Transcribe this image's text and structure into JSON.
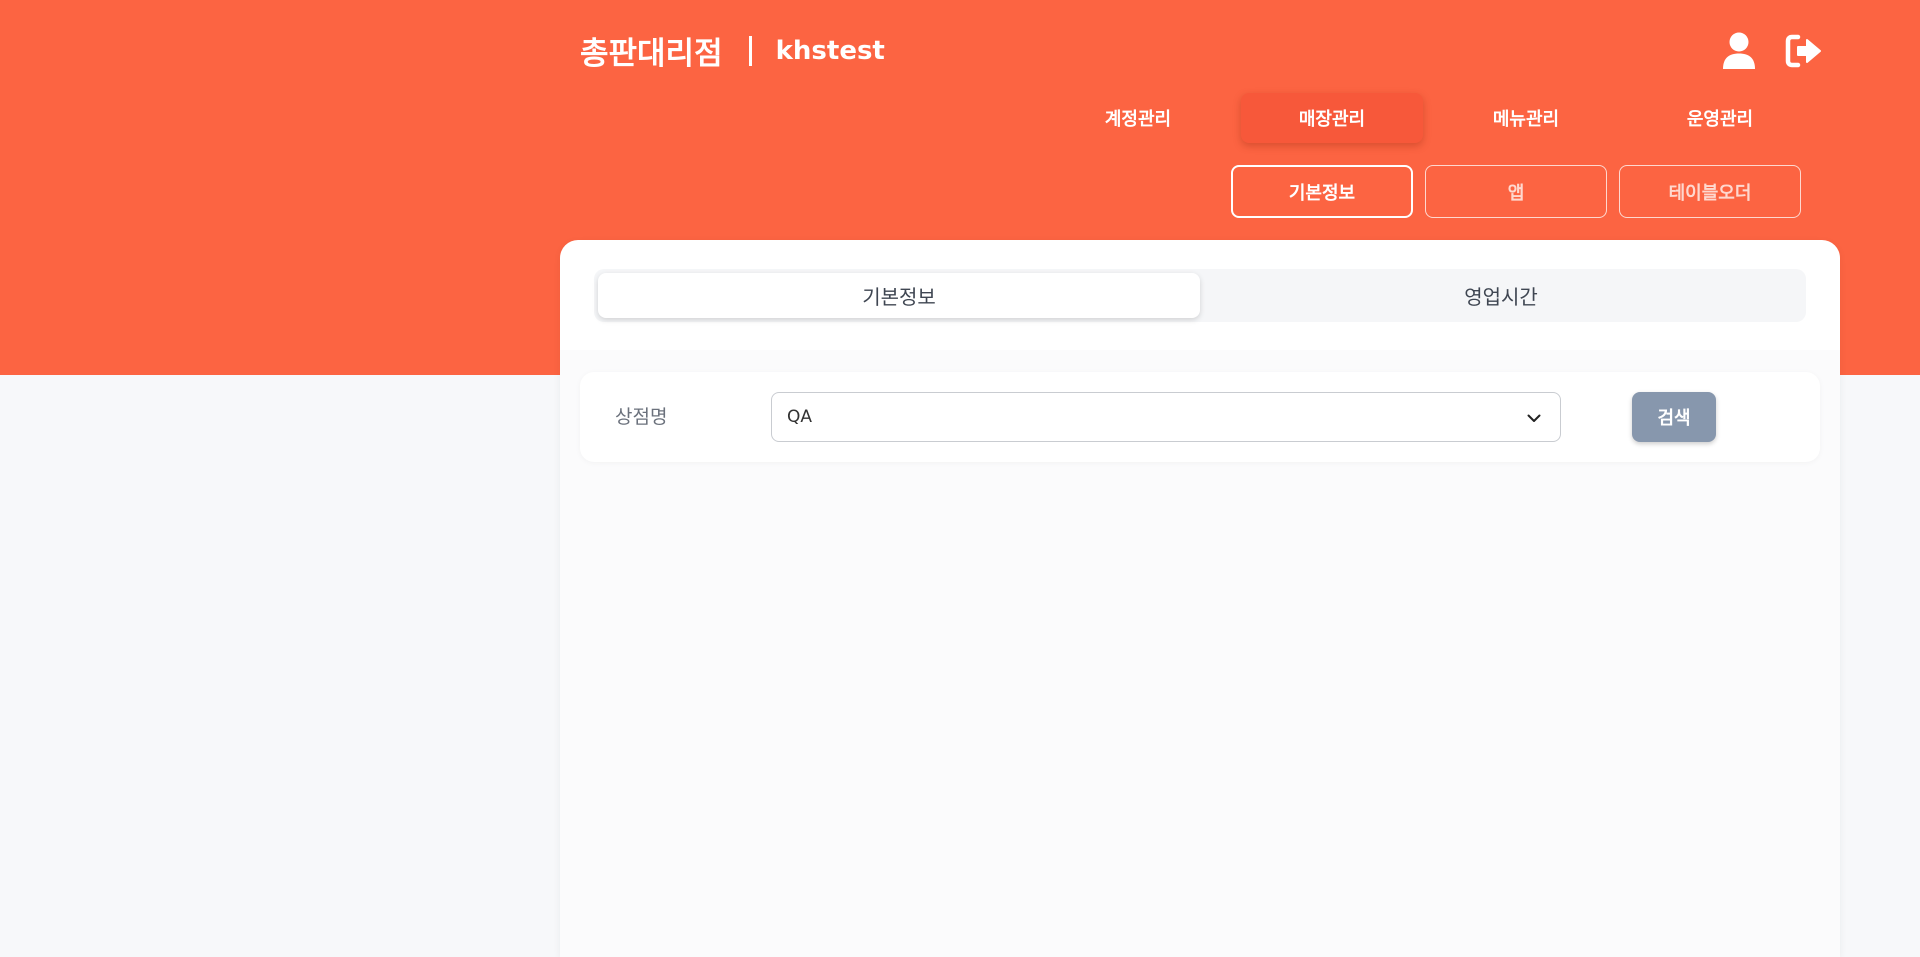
{
  "header": {
    "brand_title": "총판대리점",
    "username": "khstest",
    "icons": {
      "user": "user-icon",
      "logout": "logout-icon"
    }
  },
  "main_nav": {
    "items": [
      {
        "label": "계정관리",
        "active": false
      },
      {
        "label": "매장관리",
        "active": true
      },
      {
        "label": "메뉴관리",
        "active": false
      },
      {
        "label": "운영관리",
        "active": false
      }
    ]
  },
  "sub_nav": {
    "items": [
      {
        "label": "기본정보",
        "active": true
      },
      {
        "label": "앱",
        "active": false
      },
      {
        "label": "테이블오더",
        "active": false
      }
    ]
  },
  "content": {
    "tabs": [
      {
        "label": "기본정보",
        "active": true
      },
      {
        "label": "영업시간",
        "active": false
      }
    ],
    "filter": {
      "store_label": "상점명",
      "store_value": "QA",
      "search_label": "검색"
    }
  },
  "colors": {
    "brand": "#fc6442",
    "active_nav": "#f7583a",
    "search_button": "#8797ad",
    "page_background": "#f7f8fa"
  }
}
